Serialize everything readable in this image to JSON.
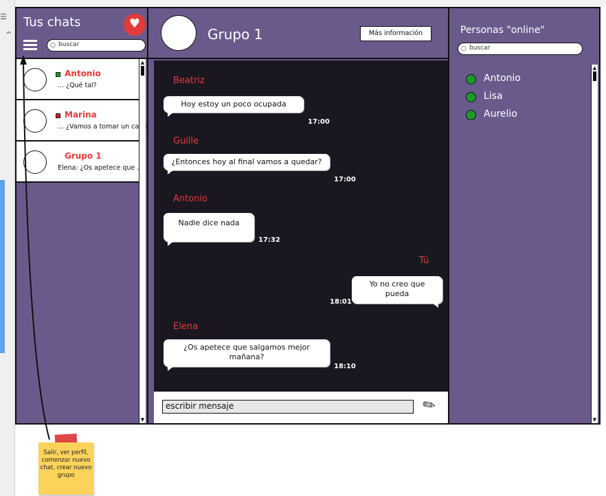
{
  "sidebar": {
    "title": "Tus chats",
    "search_placeholder": "buscar",
    "chats": [
      {
        "name": "Antonio",
        "last": "... ¿Qué tal?",
        "status": "#1b9a2a"
      },
      {
        "name": "Marina",
        "last": "... ¿Vamos a tomar un café?",
        "status": "#c0222e"
      },
      {
        "name": "Grupo 1",
        "last": "Elena: ¿Os apetece que ...",
        "status": ""
      }
    ]
  },
  "header": {
    "group_title": "Grupo 1",
    "info_label": "Más información"
  },
  "messages": [
    {
      "sender": "Beatriz",
      "text": "Hoy estoy un poco ocupada",
      "time": "17:00",
      "direction": "in"
    },
    {
      "sender": "Guille",
      "text": "¿Entonces hoy al final vamos a quedar?",
      "time": "17:00",
      "direction": "in"
    },
    {
      "sender": "Antonio",
      "text": "Nadie dice nada",
      "time": "17:32",
      "direction": "in"
    },
    {
      "sender": "Tú",
      "text": "Yo no creo que pueda",
      "time": "18:01",
      "direction": "out"
    },
    {
      "sender": "Elena",
      "text": "¿Os apetece que salgamos mejor mañana?",
      "time": "18:10",
      "direction": "in"
    }
  ],
  "composer": {
    "placeholder": "escribir mensaje"
  },
  "online": {
    "title": "Personas \"online\"",
    "search_placeholder": "buscar",
    "people": [
      "Antonio",
      "Lisa",
      "Aurelio"
    ]
  },
  "annotation": {
    "text": "Salir, ver perfil, comenzar nuevo chat, crear nuevo grupo"
  },
  "colors": {
    "panel": "#6a5a8c",
    "chat_bg": "#1b1720",
    "accent": "#e23b3b",
    "online": "#1b9a2a",
    "note": "#fbd35a"
  },
  "icons": {
    "logo": "heart-chevron-icon",
    "menu": "hamburger-icon",
    "search": "search-icon",
    "attach": "paperclip-icon"
  }
}
